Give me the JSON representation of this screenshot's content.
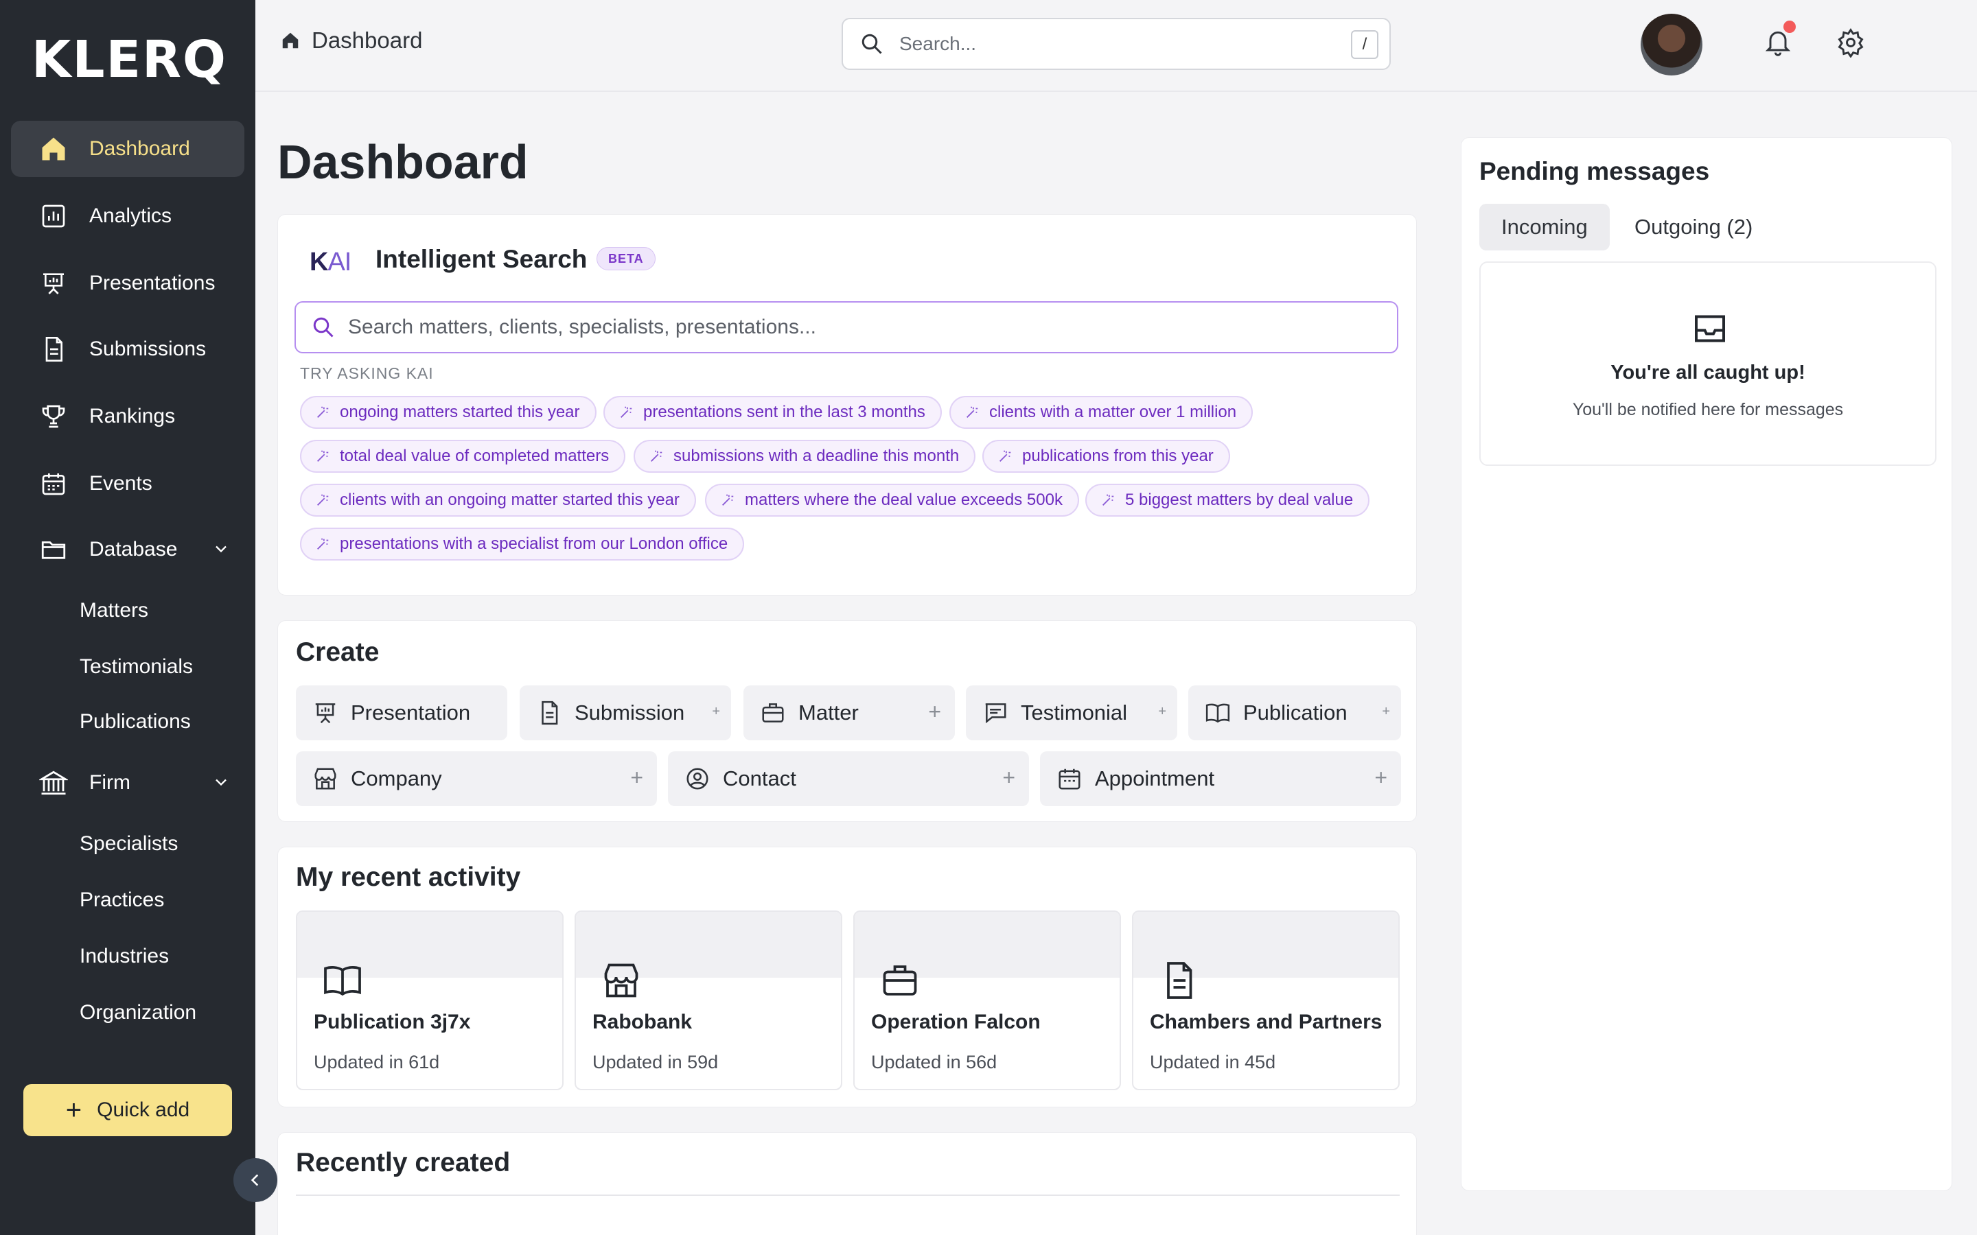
{
  "brand": {
    "logo": "KLERQ"
  },
  "sidebar": {
    "items": [
      {
        "label": "Dashboard"
      },
      {
        "label": "Analytics"
      },
      {
        "label": "Presentations"
      },
      {
        "label": "Submissions"
      },
      {
        "label": "Rankings"
      },
      {
        "label": "Events"
      },
      {
        "label": "Database"
      },
      {
        "label": "Firm"
      }
    ],
    "database_sub": [
      "Matters",
      "Testimonials",
      "Publications"
    ],
    "firm_sub": [
      "Specialists",
      "Practices",
      "Industries",
      "Organization"
    ],
    "quick_add": "Quick add"
  },
  "header": {
    "breadcrumb": "Dashboard",
    "search_placeholder": "Search...",
    "search_shortcut": "/"
  },
  "page": {
    "title": "Dashboard"
  },
  "intelligent_search": {
    "logo_k": "K",
    "logo_ai": "AI",
    "title": "Intelligent Search",
    "badge": "BETA",
    "placeholder": "Search matters, clients, specialists, presentations...",
    "try_label": "TRY ASKING KAI",
    "suggestions": [
      "ongoing matters started this year",
      "presentations sent in the last 3 months",
      "clients with a matter over 1 million",
      "total deal value of completed matters",
      "submissions with a deadline this month",
      "publications from this year",
      "clients with an ongoing matter started this year",
      "matters where the deal value exceeds 500k",
      "5 biggest matters by deal value",
      "presentations with a specialist from our London office"
    ]
  },
  "create": {
    "title": "Create",
    "buttons": [
      "Presentation",
      "Submission",
      "Matter",
      "Testimonial",
      "Publication",
      "Company",
      "Contact",
      "Appointment"
    ]
  },
  "recent_activity": {
    "title": "My recent activity",
    "items": [
      {
        "name": "Publication 3j7x",
        "updated": "Updated in 61d"
      },
      {
        "name": "Rabobank",
        "updated": "Updated in 59d"
      },
      {
        "name": "Operation Falcon",
        "updated": "Updated in 56d"
      },
      {
        "name": "Chambers and Partners",
        "updated": "Updated in 45d"
      }
    ]
  },
  "recently_created": {
    "title": "Recently created"
  },
  "pending_messages": {
    "title": "Pending messages",
    "tabs": [
      "Incoming",
      "Outgoing (2)"
    ],
    "empty_title": "You're all caught up!",
    "empty_text": "You'll be notified here for messages"
  },
  "colors": {
    "sidebar_bg": "#262a30",
    "active_text": "#f7e08a",
    "quick_add_bg": "#f8e38c",
    "accent_purple": "#7b37c9",
    "notification_dot": "#f35a5a"
  }
}
